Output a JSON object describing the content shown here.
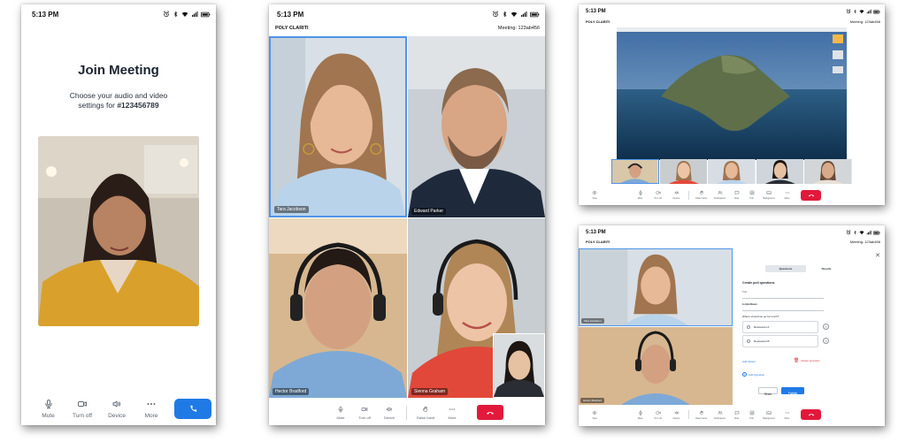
{
  "screen1": {
    "status": {
      "time": "5:13 PM"
    },
    "title": "Join Meeting",
    "subtitle_line1": "Choose your audio and video",
    "subtitle_line2_prefix": "settings for ",
    "meeting_number": "#123456789",
    "toolbar": [
      {
        "label": "Mute",
        "icon": "microphone-icon"
      },
      {
        "label": "Turn off",
        "icon": "camera-icon"
      },
      {
        "label": "Device",
        "icon": "speaker-icon"
      },
      {
        "label": "More",
        "icon": "more-dots-icon"
      }
    ],
    "join_button_icon": "phone-icon"
  },
  "screen2": {
    "status": {
      "time": "5:13 PM"
    },
    "app_name": "POLY CLARITI",
    "meeting_id": "Meeting: 123ab456",
    "participants": [
      {
        "name": "Tara Jacobson",
        "active_speaker": true
      },
      {
        "name": "Edward Parker"
      },
      {
        "name": "Hector Bradford"
      },
      {
        "name": "Sienna Graham"
      }
    ],
    "toolbar": [
      {
        "label": "Mute",
        "icon": "microphone-icon"
      },
      {
        "label": "Turn off",
        "icon": "camera-icon"
      },
      {
        "label": "Device",
        "icon": "speaker-icon"
      },
      {
        "label": "Raise hand",
        "icon": "raise-hand-icon"
      },
      {
        "label": "More",
        "icon": "more-dots-icon"
      }
    ],
    "end_call_icon": "end-call-icon"
  },
  "screen3": {
    "status": {
      "time": "5:13 PM"
    },
    "app_name": "POLY CLARITI",
    "meeting_id": "Meeting: 123ab456",
    "toolbar": [
      {
        "label": "View",
        "icon": "eye-icon"
      },
      {
        "label": "Mute",
        "icon": "microphone-icon"
      },
      {
        "label": "Turn off",
        "icon": "camera-icon"
      },
      {
        "label": "Device",
        "icon": "speaker-icon"
      },
      {
        "label": "Raise hand",
        "icon": "raise-hand-icon"
      },
      {
        "label": "Participants",
        "icon": "participants-icon"
      },
      {
        "label": "Chat",
        "icon": "chat-icon"
      },
      {
        "label": "Poll",
        "icon": "poll-icon"
      },
      {
        "label": "Background",
        "icon": "background-icon"
      },
      {
        "label": "More",
        "icon": "more-dots-icon"
      }
    ]
  },
  "screen4": {
    "status": {
      "time": "5:13 PM"
    },
    "app_name": "POLY CLARITI",
    "meeting_id": "Meeting: 123ab456",
    "participants": [
      {
        "name": "Tara Jacobson"
      },
      {
        "name": "Hector Bradford"
      }
    ],
    "poll": {
      "tabs": [
        "Questions",
        "Results"
      ],
      "heading": "Create poll questions",
      "title_label": "Title",
      "title_value": "Lunch Break",
      "question_label": "1. Question",
      "question_value": "Where should we go for lunch?",
      "options": [
        "Restaurant A",
        "Restaurant B"
      ],
      "add_option": "Add Option",
      "delete_question": "Delete Question",
      "add_question": "Add Question",
      "reset": "Reset",
      "publish": "Publish"
    },
    "toolbar": [
      {
        "label": "View",
        "icon": "eye-icon"
      },
      {
        "label": "Mute",
        "icon": "microphone-icon"
      },
      {
        "label": "Turn off",
        "icon": "camera-icon"
      },
      {
        "label": "Device",
        "icon": "speaker-icon"
      },
      {
        "label": "Raise hand",
        "icon": "raise-hand-icon"
      },
      {
        "label": "Participants",
        "icon": "participants-icon"
      },
      {
        "label": "Chat",
        "icon": "chat-icon"
      },
      {
        "label": "Poll",
        "icon": "poll-icon"
      },
      {
        "label": "Background",
        "icon": "background-icon"
      },
      {
        "label": "More",
        "icon": "more-dots-icon"
      }
    ]
  },
  "colors": {
    "accent_blue": "#1f7ae6",
    "end_call_red": "#e2193b",
    "active_speaker_border": "#4f95e8"
  }
}
